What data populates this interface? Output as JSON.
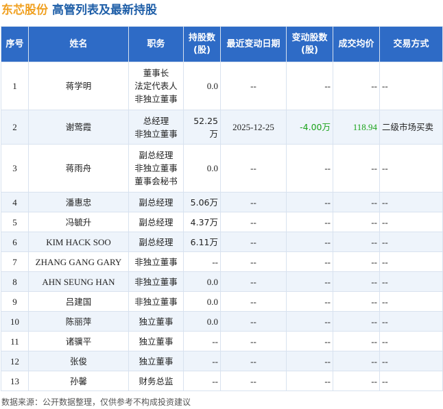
{
  "header": {
    "company": "东芯股份",
    "subject": "高管列表及最新持股"
  },
  "table": {
    "columns": [
      "序号",
      "姓名",
      "职务",
      "持股数\n(股)",
      "最近变动日期",
      "变动股数\n(股)",
      "成交均价",
      "交易方式"
    ],
    "rows": [
      {
        "no": "1",
        "name": "蒋学明",
        "role": "董事长\n法定代表人\n非独立董事",
        "shares": "0.0",
        "date": "--",
        "change": "--",
        "price": "--",
        "method": "--"
      },
      {
        "no": "2",
        "name": "谢莺霞",
        "role": "总经理\n非独立董事",
        "shares": "52.25万",
        "date": "2025-12-25",
        "change": "-4.00万",
        "price": "118.94",
        "method": "二级市场买卖"
      },
      {
        "no": "3",
        "name": "蒋雨舟",
        "role": "副总经理\n非独立董事\n董事会秘书",
        "shares": "0.0",
        "date": "--",
        "change": "--",
        "price": "--",
        "method": "--"
      },
      {
        "no": "4",
        "name": "潘惠忠",
        "role": "副总经理",
        "shares": "5.06万",
        "date": "--",
        "change": "--",
        "price": "--",
        "method": "--"
      },
      {
        "no": "5",
        "name": "冯毓升",
        "role": "副总经理",
        "shares": "4.37万",
        "date": "--",
        "change": "--",
        "price": "--",
        "method": "--"
      },
      {
        "no": "6",
        "name": "KIM HACK SOO",
        "role": "副总经理",
        "shares": "6.11万",
        "date": "--",
        "change": "--",
        "price": "--",
        "method": "--"
      },
      {
        "no": "7",
        "name": "ZHANG GANG GARY",
        "role": "非独立董事",
        "shares": "--",
        "date": "--",
        "change": "--",
        "price": "--",
        "method": "--"
      },
      {
        "no": "8",
        "name": "AHN SEUNG HAN",
        "role": "非独立董事",
        "shares": "0.0",
        "date": "--",
        "change": "--",
        "price": "--",
        "method": "--"
      },
      {
        "no": "9",
        "name": "吕建国",
        "role": "非独立董事",
        "shares": "0.0",
        "date": "--",
        "change": "--",
        "price": "--",
        "method": "--"
      },
      {
        "no": "10",
        "name": "陈丽萍",
        "role": "独立董事",
        "shares": "0.0",
        "date": "--",
        "change": "--",
        "price": "--",
        "method": "--"
      },
      {
        "no": "11",
        "name": "诸骥平",
        "role": "独立董事",
        "shares": "--",
        "date": "--",
        "change": "--",
        "price": "--",
        "method": "--"
      },
      {
        "no": "12",
        "name": "张俊",
        "role": "独立董事",
        "shares": "--",
        "date": "--",
        "change": "--",
        "price": "--",
        "method": "--"
      },
      {
        "no": "13",
        "name": "孙馨",
        "role": "财务总监",
        "shares": "--",
        "date": "--",
        "change": "--",
        "price": "--",
        "method": "--"
      }
    ]
  },
  "footer": {
    "source": "数据来源：公开数据整理，仅供参考不构成投资建议"
  },
  "colors": {
    "header_bg": "#2e6bc6",
    "company": "#f0a020",
    "subject": "#1f5fa8",
    "change": "#1aa31a"
  }
}
